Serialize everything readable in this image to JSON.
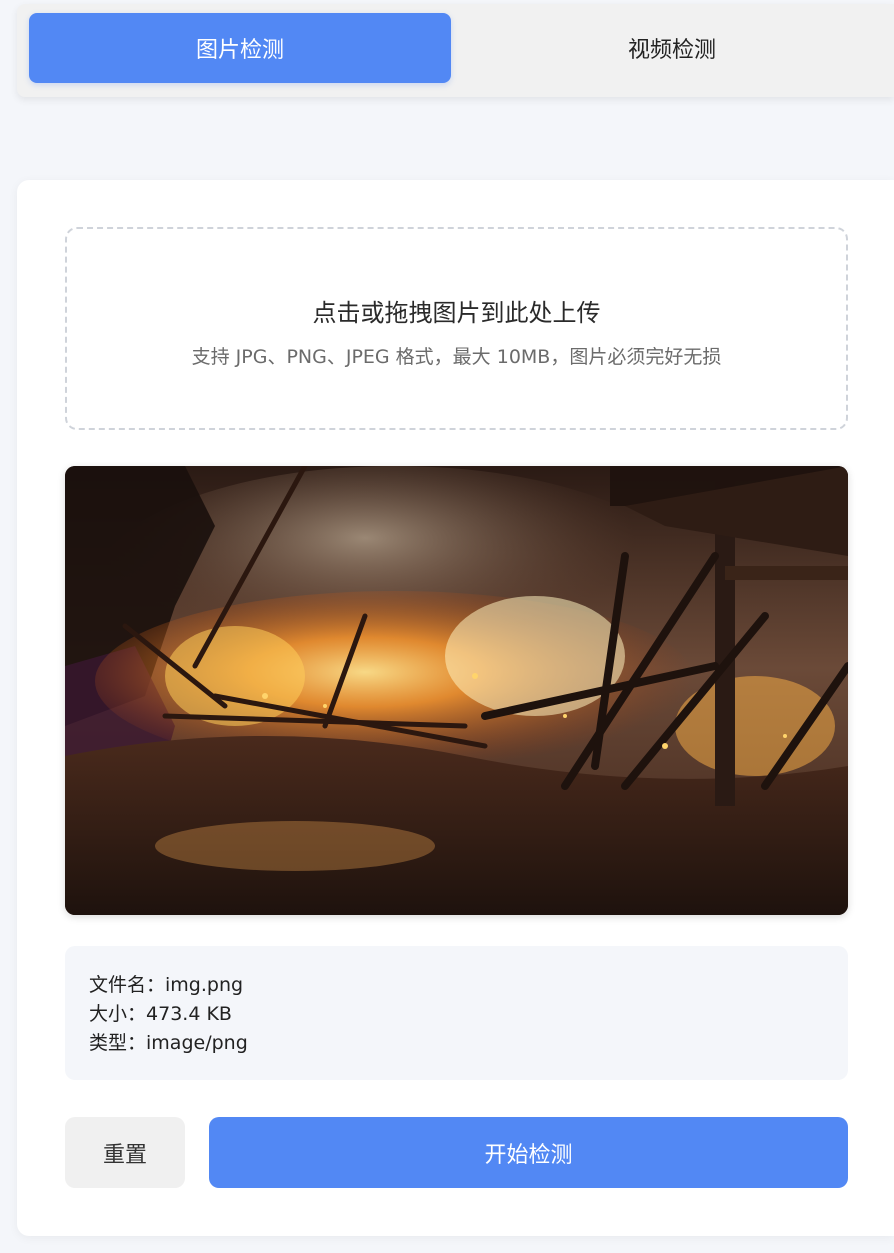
{
  "tabs": {
    "image_label": "图片检测",
    "video_label": "视频检测"
  },
  "upload": {
    "title": "点击或拖拽图片到此处上传",
    "hint": "支持 JPG、PNG、JPEG 格式，最大 10MB，图片必须完好无损"
  },
  "file_info": {
    "name_label": "文件名：",
    "name_value": "img.png",
    "size_label": "大小：",
    "size_value": "473.4 KB",
    "type_label": "类型：",
    "type_value": "image/png"
  },
  "actions": {
    "reset_label": "重置",
    "start_label": "开始检测"
  },
  "colors": {
    "accent": "#5288f4",
    "background": "#f4f6fa"
  }
}
